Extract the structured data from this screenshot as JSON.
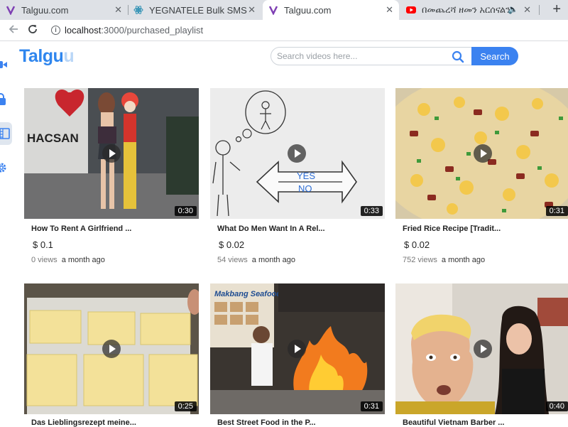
{
  "browser": {
    "tabs": [
      {
        "title": "Talguu.com",
        "active": false
      },
      {
        "title": "YEGNATELE Bulk SMS & IV",
        "active": false
      },
      {
        "title": "Talguu.com",
        "active": true
      },
      {
        "title": "በመጨረሻ ዘመን አርሰናልን ሁ",
        "active": false
      }
    ],
    "url_host": "localhost",
    "url_rest": ":3000/purchased_playlist"
  },
  "app": {
    "logo_main": "Talgu",
    "logo_tail": "u",
    "search_placeholder": "Search videos here...",
    "search_button": "Search",
    "accent": "#3b82f0"
  },
  "videos": [
    {
      "title": "How To Rent A Girlfriend ...",
      "price": "$ 0.1",
      "views": "0 views",
      "ago": "a month ago",
      "duration": "0:30"
    },
    {
      "title": "What Do Men Want In A Rel...",
      "price": "$ 0.02",
      "views": "54 views",
      "ago": "a month ago",
      "duration": "0:33"
    },
    {
      "title": "Fried Rice Recipe [Tradit...",
      "price": "$ 0.02",
      "views": "752 views",
      "ago": "a month ago",
      "duration": "0:31"
    },
    {
      "title": "Das Lieblingsrezept meine...",
      "duration": "0:25"
    },
    {
      "title": "Best Street Food in the P...",
      "duration": "0:31"
    },
    {
      "title": "Beautiful Vietnam Barber ...",
      "duration": "0:40"
    }
  ],
  "whiteboard": {
    "yes": "YES",
    "no": "NO"
  },
  "sign": {
    "makbang": "Makbang Seafood",
    "chasang": "HACSAN"
  }
}
